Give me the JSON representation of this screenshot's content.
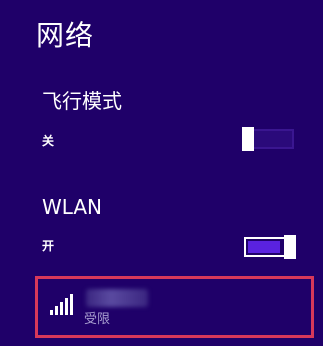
{
  "panel": {
    "title": "网络"
  },
  "airplane_mode": {
    "label": "飞行模式",
    "state_label": "关",
    "on": false
  },
  "wlan": {
    "label": "WLAN",
    "state_label": "开",
    "on": true
  },
  "networks": [
    {
      "name_visible": false,
      "status": "受限",
      "signal_bars": 5
    }
  ],
  "colors": {
    "background": "#1f0069",
    "toggle_on_fill": "#5a22e0",
    "highlight_border": "#d8385a",
    "status_text": "#a89ed0"
  },
  "icons": {
    "signal": "wifi-signal-icon"
  }
}
